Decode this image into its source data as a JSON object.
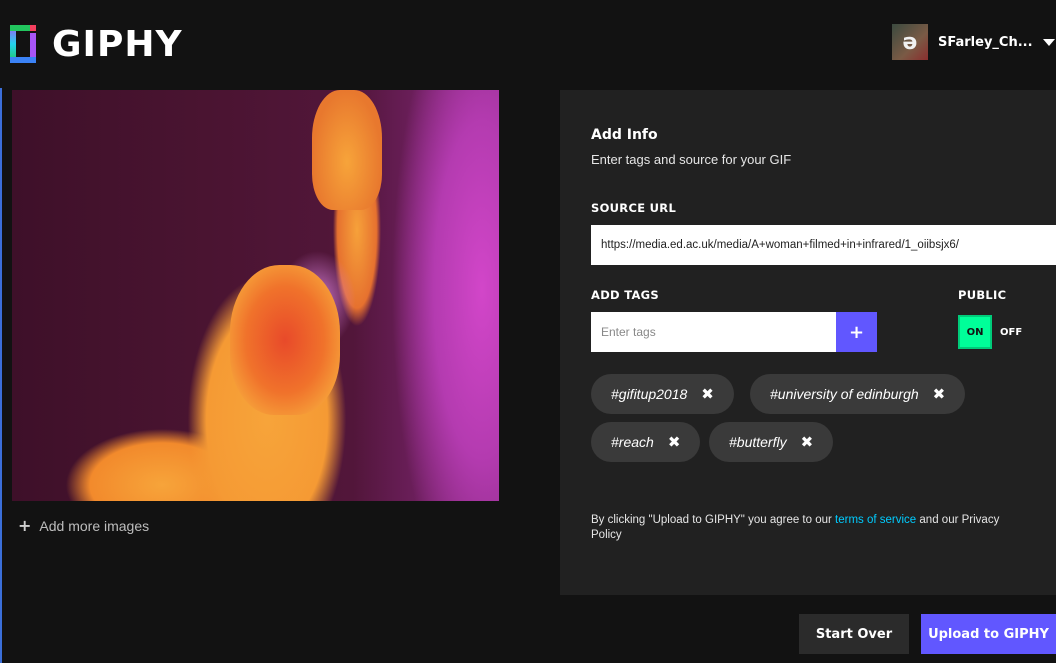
{
  "header": {
    "logo_text": "GIPHY",
    "avatar_letter": "ə",
    "username": "SFarley_Ch...",
    "menu_icon": "chevron-down-icon"
  },
  "preview": {
    "add_more_label": "Add more images"
  },
  "panel": {
    "title": "Add Info",
    "subtitle": "Enter tags and source for your GIF",
    "source_label": "SOURCE URL",
    "source_value": "https://media.ed.ac.uk/media/A+woman+filmed+in+infrared/1_oiibsjx6/",
    "tags_label": "ADD TAGS",
    "tags_placeholder": "Enter tags",
    "tags_add": "+",
    "public_label": "PUBLIC",
    "toggle_on": "ON",
    "toggle_off": "OFF",
    "tags": [
      {
        "label": "#gifitup2018"
      },
      {
        "label": "#university of edinburgh"
      },
      {
        "label": "#reach"
      },
      {
        "label": "#butterfly"
      }
    ],
    "remove_glyph": "✖",
    "legal_prefix": "By clicking \"Upload to GIPHY\" you agree to our ",
    "legal_link": "terms of service",
    "legal_suffix": " and our Privacy Policy"
  },
  "actions": {
    "start_over": "Start Over",
    "upload": "Upload to GIPHY"
  },
  "colors": {
    "accent": "#6157ff",
    "toggle_on": "#00ff99",
    "link": "#00ccff",
    "panel_bg": "#212121",
    "page_bg": "#121212"
  }
}
